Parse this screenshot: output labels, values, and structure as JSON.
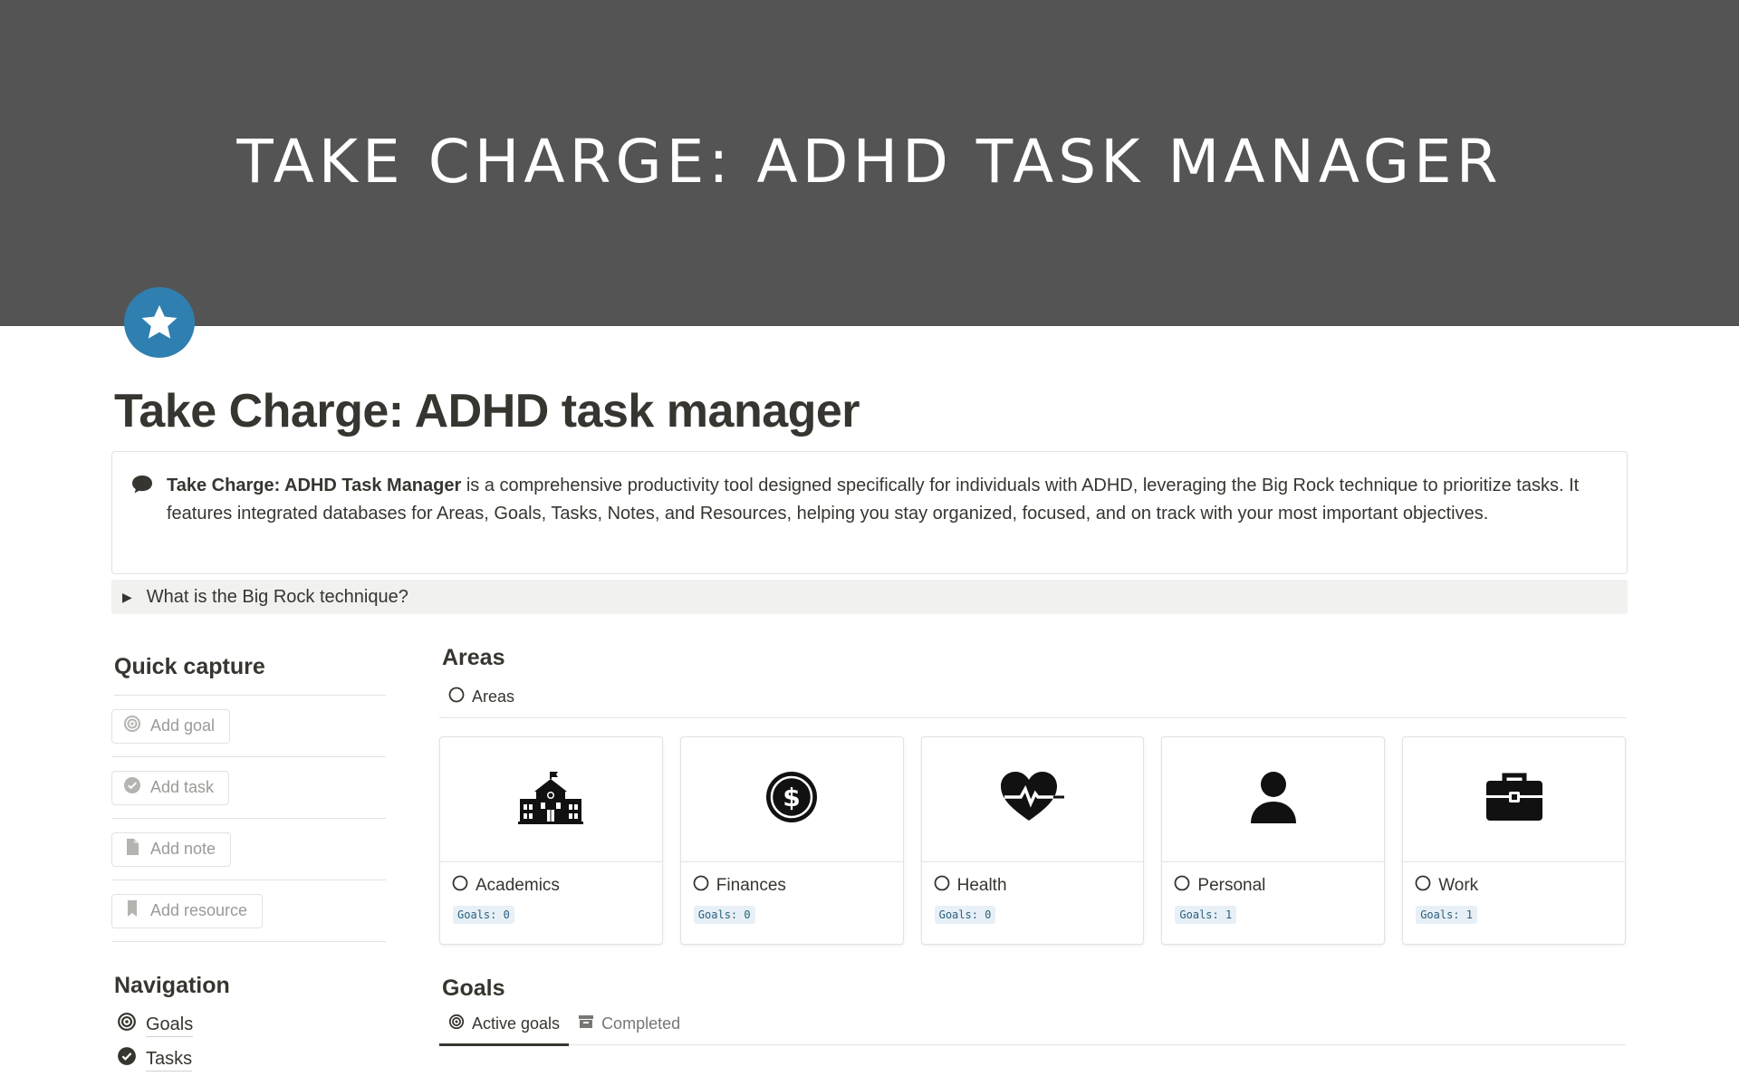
{
  "cover": {
    "title": "TAKE CHARGE: ADHD TASK MANAGER",
    "bg_color": "#545454"
  },
  "page": {
    "icon": "star-icon",
    "icon_color": "#2f7fb0",
    "title": "Take Charge: ADHD task manager"
  },
  "callout": {
    "icon": "speech-bubble-icon",
    "bold_text": "Take Charge: ADHD Task Manager",
    "body_text": " is a comprehensive productivity tool designed specifically for individuals with ADHD, leveraging the Big Rock technique to prioritize tasks. It features integrated databases for Areas, Goals, Tasks, Notes, and Resources, helping you stay organized, focused, and on track with your most important objectives."
  },
  "toggle": {
    "label": "What is the Big Rock technique?"
  },
  "quick_capture": {
    "heading": "Quick capture",
    "buttons": [
      {
        "label": "Add goal",
        "icon": "target-icon"
      },
      {
        "label": "Add task",
        "icon": "check-circle-icon"
      },
      {
        "label": "Add note",
        "icon": "document-icon"
      },
      {
        "label": "Add resource",
        "icon": "bookmark-icon"
      }
    ]
  },
  "navigation": {
    "heading": "Navigation",
    "items": [
      {
        "label": "Goals",
        "icon": "target-icon"
      },
      {
        "label": "Tasks",
        "icon": "check-circle-icon"
      }
    ]
  },
  "areas": {
    "heading": "Areas",
    "view_tab": "Areas",
    "cards": [
      {
        "name": "Academics",
        "badge": "Goals: 0",
        "icon": "school-icon"
      },
      {
        "name": "Finances",
        "badge": "Goals: 0",
        "icon": "dollar-coin-icon"
      },
      {
        "name": "Health",
        "badge": "Goals: 0",
        "icon": "heartbeat-icon"
      },
      {
        "name": "Personal",
        "badge": "Goals: 1",
        "icon": "person-icon"
      },
      {
        "name": "Work",
        "badge": "Goals: 1",
        "icon": "briefcase-icon"
      }
    ]
  },
  "goals": {
    "heading": "Goals",
    "tabs": [
      {
        "label": "Active goals",
        "icon": "target-icon"
      },
      {
        "label": "Completed",
        "icon": "archive-icon"
      }
    ]
  }
}
